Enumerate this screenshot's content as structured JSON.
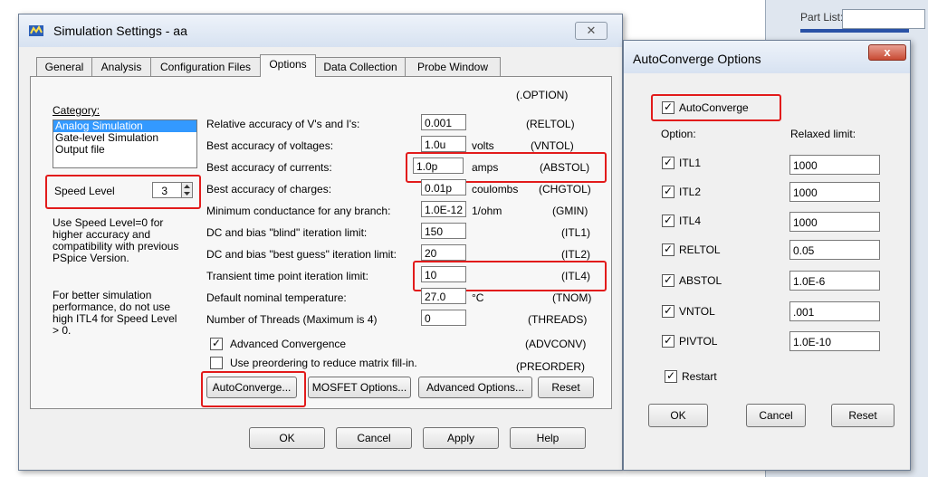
{
  "background": {
    "part_list_label": "Part List:"
  },
  "sim": {
    "title": "Simulation Settings - aa",
    "close_glyph": "✕",
    "tabs": [
      "General",
      "Analysis",
      "Configuration Files",
      "Options",
      "Data Collection",
      "Probe Window"
    ],
    "active_tab": "Options",
    "option_header": "(.OPTION)",
    "category_label": "Category:",
    "categories": [
      "Analog Simulation",
      "Gate-level Simulation",
      "Output file"
    ],
    "selected_category": "Analog Simulation",
    "speed_level_label": "Speed Level",
    "speed_level_value": "3",
    "help_text_1": [
      "Use Speed Level=0 for",
      "higher accuracy and",
      "compatibility with previous",
      "PSpice Version."
    ],
    "help_text_2": [
      "For better simulation",
      "performance, do not use",
      "high ITL4 for Speed Level",
      "> 0."
    ],
    "params": [
      {
        "label": "Relative accuracy of V's and I's:",
        "value": "0.001",
        "unit": "",
        "option": "(RELTOL)"
      },
      {
        "label": "Best accuracy of voltages:",
        "value": "1.0u",
        "unit": "volts",
        "option": "(VNTOL)"
      },
      {
        "label": "Best accuracy of currents:",
        "value": "1.0p",
        "unit": "amps",
        "option": "(ABSTOL)"
      },
      {
        "label": "Best accuracy of charges:",
        "value": "0.01p",
        "unit": "coulombs",
        "option": "(CHGTOL)"
      },
      {
        "label": "Minimum conductance for any branch:",
        "value": "1.0E-12",
        "unit": "1/ohm",
        "option": "(GMIN)"
      },
      {
        "label": "DC and bias \"blind\" iteration limit:",
        "value": "150",
        "unit": "",
        "option": "(ITL1)"
      },
      {
        "label": "DC and bias \"best guess\" iteration limit:",
        "value": "20",
        "unit": "",
        "option": "(ITL2)"
      },
      {
        "label": "Transient time point iteration limit:",
        "value": "10",
        "unit": "",
        "option": "(ITL4)"
      },
      {
        "label": "Default nominal temperature:",
        "value": "27.0",
        "unit": "°C",
        "option": "(TNOM)"
      },
      {
        "label": "Number of Threads (Maximum is 4)",
        "value": "0",
        "unit": "",
        "option": "(THREADS)"
      }
    ],
    "adv_conv_label": "Advanced Convergence",
    "adv_conv_checked": true,
    "adv_conv_option": "(ADVCONV)",
    "preorder_label": "Use preordering to reduce matrix fill-in.",
    "preorder_checked": false,
    "preorder_option": "(PREORDER)",
    "buttons": {
      "autoconverge": "AutoConverge...",
      "mosfet": "MOSFET Options...",
      "advanced": "Advanced Options...",
      "reset": "Reset",
      "ok": "OK",
      "cancel": "Cancel",
      "apply": "Apply",
      "help": "Help"
    }
  },
  "ac": {
    "title": "AutoConverge Options",
    "close_glyph": "x",
    "autoconverge_label": "AutoConverge",
    "autoconverge_checked": true,
    "col_option": "Option:",
    "col_limit": "Relaxed limit:",
    "rows": [
      {
        "name": "ITL1",
        "checked": true,
        "value": "1000"
      },
      {
        "name": "ITL2",
        "checked": true,
        "value": "1000"
      },
      {
        "name": "ITL4",
        "checked": true,
        "value": "1000"
      },
      {
        "name": "RELTOL",
        "checked": true,
        "value": "0.05"
      },
      {
        "name": "ABSTOL",
        "checked": true,
        "value": "1.0E-6"
      },
      {
        "name": "VNTOL",
        "checked": true,
        "value": ".001"
      },
      {
        "name": "PIVTOL",
        "checked": true,
        "value": "1.0E-10"
      }
    ],
    "restart_label": "Restart",
    "restart_checked": true,
    "buttons": {
      "ok": "OK",
      "cancel": "Cancel",
      "reset": "Reset"
    }
  },
  "colors": {
    "highlight": "#e21b1b",
    "selection": "#3399ff"
  }
}
